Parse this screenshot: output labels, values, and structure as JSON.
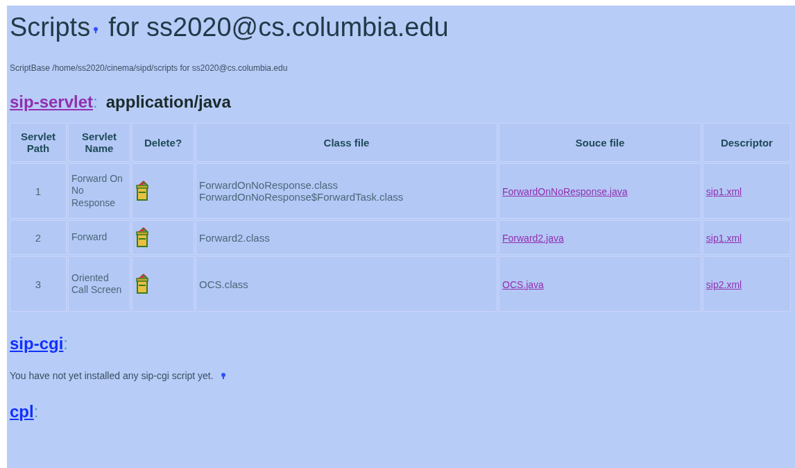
{
  "title": {
    "text": "Scripts",
    "suffix": "for ss2020@cs.columbia.edu"
  },
  "script_base": "ScriptBase /home/ss2020/cinema/sipd/scripts for ss2020@cs.columbia.edu",
  "sections": [
    {
      "name": "sip-servlet",
      "separator": ":",
      "visited": true,
      "mime": "application/java",
      "kind": "table",
      "table": {
        "columns": [
          "Servlet Path",
          "Servlet Name",
          "Delete?",
          "Class file",
          "Souce file",
          "Descriptor"
        ],
        "rows": [
          {
            "path": "1",
            "name": "Forward On No Response",
            "class_files": [
              "ForwardOnNoResponse.class",
              "ForwardOnNoResponse$ForwardTask.class"
            ],
            "source": "ForwardOnNoResponse.java",
            "descriptor": "sip1.xml"
          },
          {
            "path": "2",
            "name": "Forward",
            "class_files": [
              "Forward2.class"
            ],
            "source": "Forward2.java",
            "descriptor": "sip1.xml"
          },
          {
            "path": "3",
            "name": "Oriented Call Screen",
            "class_files": [
              "OCS.class"
            ],
            "source": "OCS.java",
            "descriptor": "sip2.xml"
          }
        ]
      }
    },
    {
      "name": "sip-cgi",
      "separator": ":",
      "visited": false,
      "kind": "message",
      "message": "You have not yet installed any sip-cgi script yet."
    },
    {
      "name": "cpl",
      "separator": ":",
      "visited": false,
      "kind": "empty"
    }
  ]
}
